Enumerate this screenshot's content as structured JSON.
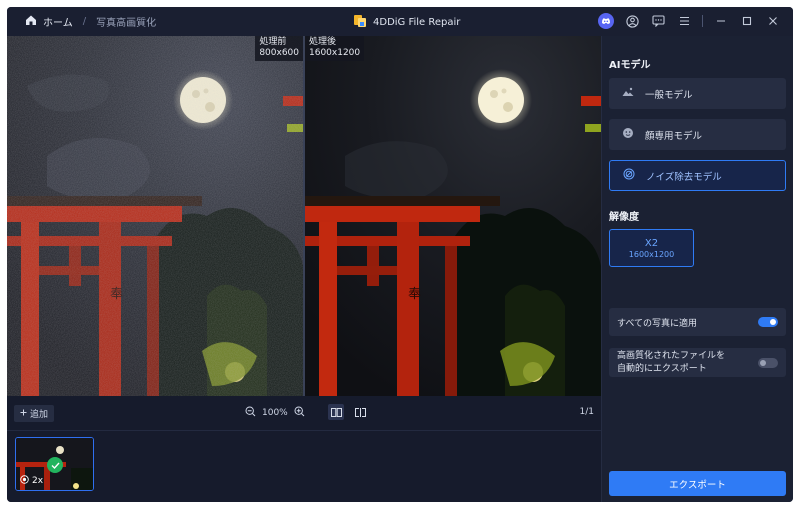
{
  "titlebar": {
    "home_label": "ホーム",
    "separator": "/",
    "page_label": "写真高画質化",
    "app_name": "4DDiG File Repair"
  },
  "viewer": {
    "before": {
      "label": "処理前",
      "size": "800x600"
    },
    "after": {
      "label": "処理後",
      "size": "1600x1200"
    }
  },
  "toolbar": {
    "add_label": "追加",
    "zoom": "100%",
    "page_count": "1/1"
  },
  "thumbnails": [
    {
      "scale": "2x",
      "done": true
    }
  ],
  "panel": {
    "ai_model_title": "AIモデル",
    "models": [
      {
        "label": "一般モデル",
        "icon": "landscape-icon",
        "active": false
      },
      {
        "label": "顔専用モデル",
        "icon": "face-icon",
        "active": false
      },
      {
        "label": "ノイズ除去モデル",
        "icon": "denoise-icon",
        "active": true
      }
    ],
    "resolution_title": "解像度",
    "resolution": {
      "scale": "X2",
      "size": "1600x1200"
    },
    "apply_all": {
      "label": "すべての写真に適用",
      "on": true
    },
    "auto_export": {
      "label_line1": "高画質化されたファイルを",
      "label_line2": "自動的にエクスポート",
      "on": false
    },
    "export_label": "エクスポート"
  },
  "colors": {
    "accent": "#2f7bf5",
    "background": "#161b2c",
    "panel": "#1b2133"
  }
}
